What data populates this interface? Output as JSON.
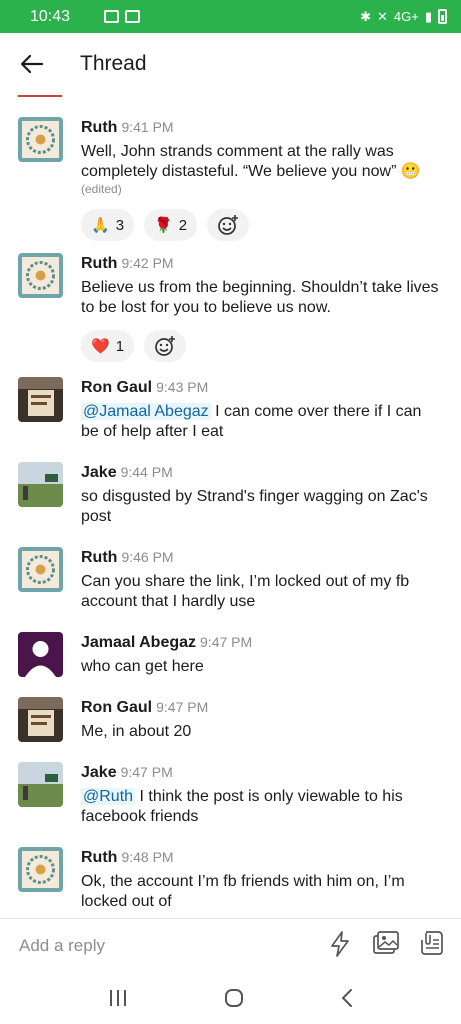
{
  "status": {
    "time": "10:43",
    "network": "4G+"
  },
  "header": {
    "title": "Thread"
  },
  "messages": [
    {
      "name": "Ruth",
      "time": "9:41 PM",
      "avatar": "quilt",
      "text": "Well, John strands comment at the rally was completely distasteful. “We believe you now” 😬",
      "edited": "(edited)",
      "reactions": [
        {
          "emoji": "🙏",
          "count": "3"
        },
        {
          "emoji": "🌹",
          "count": "2"
        }
      ]
    },
    {
      "name": "Ruth",
      "time": "9:42 PM",
      "avatar": "quilt",
      "text": "Believe us from the beginning. Shouldn’t take lives to be lost for you to believe us now.",
      "reactions": [
        {
          "emoji": "❤️",
          "count": "1"
        }
      ]
    },
    {
      "name": "Ron Gaul",
      "time": "9:43 PM",
      "avatar": "photo-sign",
      "mention": "@Jamaal Abegaz",
      "text": " I can come over there if I can be of help after I eat"
    },
    {
      "name": "Jake",
      "time": "9:44 PM",
      "avatar": "photo-field",
      "text": "so disgusted by Strand's finger wagging on Zac's post"
    },
    {
      "name": "Ruth",
      "time": "9:46 PM",
      "avatar": "quilt",
      "text": "Can you share the link, I’m locked out of my fb account that I hardly use"
    },
    {
      "name": "Jamaal Abegaz",
      "time": "9:47 PM",
      "avatar": "default",
      "text": "who can get here"
    },
    {
      "name": "Ron Gaul",
      "time": "9:47 PM",
      "avatar": "photo-sign",
      "text": "Me, in about 20"
    },
    {
      "name": "Jake",
      "time": "9:47 PM",
      "avatar": "photo-field",
      "mention": "@Ruth",
      "text": " I think the post is only viewable to his facebook friends"
    },
    {
      "name": "Ruth",
      "time": "9:48 PM",
      "avatar": "quilt",
      "text": "Ok, the account I’m fb friends with him on, I’m locked out of"
    }
  ],
  "composer": {
    "placeholder": "Add a reply"
  },
  "colors": {
    "status_bar": "#2bb24c",
    "mention": "#1264a3",
    "jamaal_avatar": "#4a154b"
  }
}
